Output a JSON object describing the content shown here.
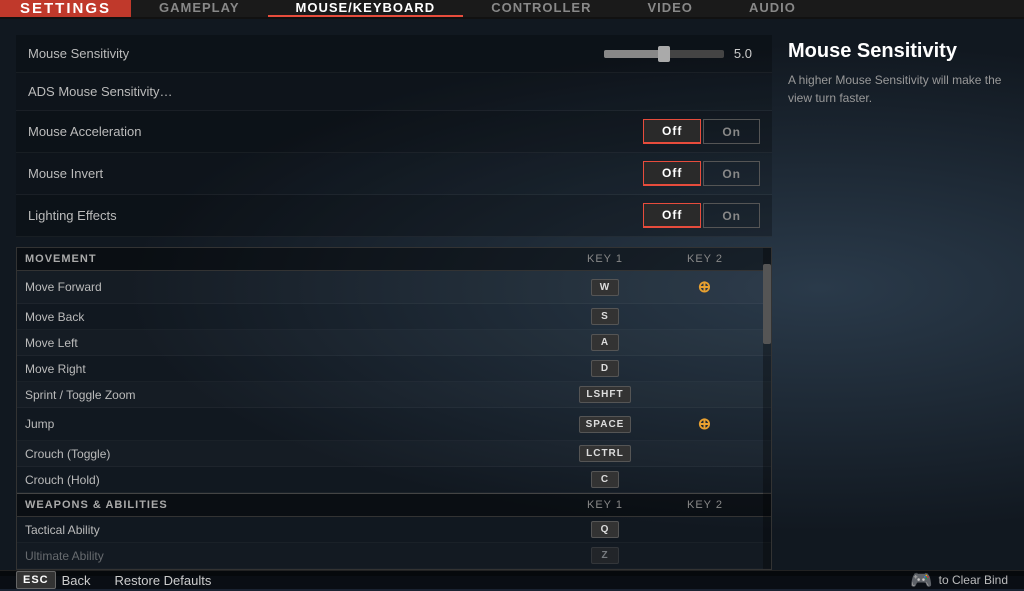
{
  "app": {
    "settings_label": "SETTINGS"
  },
  "nav": {
    "tabs": [
      {
        "id": "gameplay",
        "label": "GAMEPLAY",
        "active": false
      },
      {
        "id": "mouse_keyboard",
        "label": "MOUSE/KEYBOARD",
        "active": true
      },
      {
        "id": "controller",
        "label": "CONTROLLER",
        "active": false
      },
      {
        "id": "video",
        "label": "VIDEO",
        "active": false
      },
      {
        "id": "audio",
        "label": "AUDIO",
        "active": false
      }
    ]
  },
  "settings": {
    "mouse_sensitivity": {
      "label": "Mouse Sensitivity",
      "value": "5.0"
    },
    "ads_sensitivity": {
      "label": "ADS Mouse Sensitivity…"
    },
    "mouse_acceleration": {
      "label": "Mouse Acceleration",
      "off": "Off",
      "on": "On"
    },
    "mouse_invert": {
      "label": "Mouse Invert",
      "off": "Off",
      "on": "On"
    },
    "lighting_effects": {
      "label": "Lighting Effects",
      "off": "Off",
      "on": "On"
    }
  },
  "keybinds": {
    "movement_header": "MOVEMENT",
    "weapons_header": "WEAPONS & ABILITIES",
    "key1_col": "KEY 1",
    "key2_col": "KEY 2",
    "actions": [
      {
        "label": "Move Forward",
        "key1": "W",
        "key2": "ctrl_icon"
      },
      {
        "label": "Move Back",
        "key1": "S",
        "key2": ""
      },
      {
        "label": "Move Left",
        "key1": "A",
        "key2": ""
      },
      {
        "label": "Move Right",
        "key1": "D",
        "key2": ""
      },
      {
        "label": "Sprint / Toggle Zoom",
        "key1": "LSHFT",
        "key2": ""
      },
      {
        "label": "Jump",
        "key1": "SPACE",
        "key2": "ctrl_icon2"
      },
      {
        "label": "Crouch (Toggle)",
        "key1": "LCTRL",
        "key2": ""
      },
      {
        "label": "Crouch (Hold)",
        "key1": "C",
        "key2": ""
      }
    ],
    "weapon_actions": [
      {
        "label": "Tactical Ability",
        "key1": "Q",
        "key2": ""
      },
      {
        "label": "Ultimate Ability",
        "key1": "Z",
        "key2": ""
      }
    ]
  },
  "help": {
    "title": "Mouse Sensitivity",
    "description": "A higher Mouse Sensitivity will make the view turn faster."
  },
  "bottom": {
    "esc_label": "ESC",
    "back_label": "Back",
    "restore_label": "Restore Defaults",
    "clear_bind_icon": "🎮",
    "clear_bind_text": "to Clear Bind"
  }
}
